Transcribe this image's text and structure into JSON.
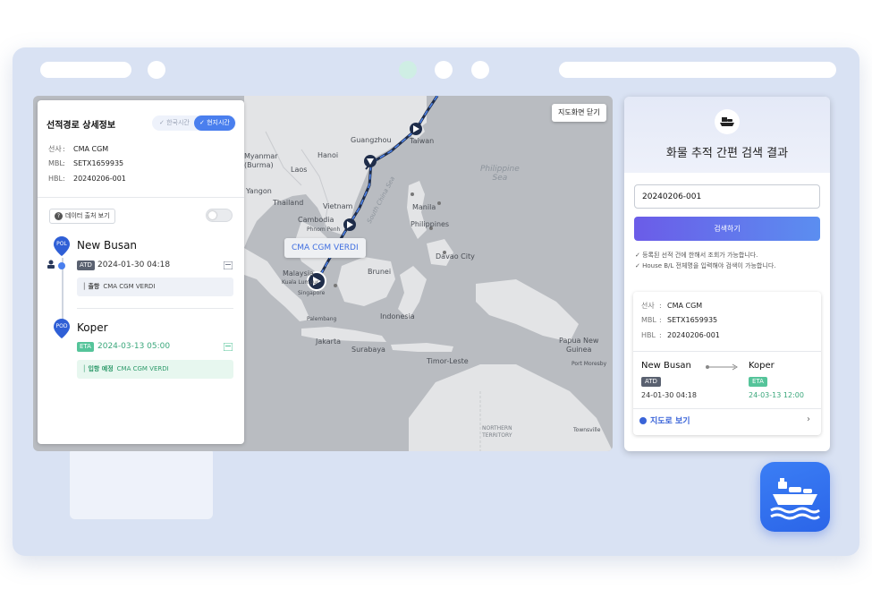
{
  "map": {
    "close_label": "지도화면 닫기",
    "vessel_label": "CMA CGM VERDI",
    "labels": {
      "taiwan": "Taiwan",
      "myanmar": "Myanmar\n(Burma)",
      "laos": "Laos",
      "yangon": "Yangon",
      "thailand": "Thailand",
      "vietnam": "Vietnam",
      "cambodia": "Cambodia",
      "philippine_sea": "Philippine\nSea",
      "philippines": "Philippines",
      "manila": "Manila",
      "davao": "Davao City",
      "malaysia": "Malaysia",
      "brunei": "Brunei",
      "singapore": "Singapore",
      "indonesia": "Indonesia",
      "jakarta": "Jakarta",
      "surabaya": "Surabaya",
      "timor_leste": "Timor-Leste",
      "papua": "Papua New\nGuinea",
      "port_moresby": "Port Moresby",
      "northern_territory": "NORTHERN\nTERRITORY",
      "townsville": "Townsville",
      "guangzhou": "Guangzhou",
      "hanoi": "Hanoi",
      "south_china_sea": "South China Sea",
      "phnom_penh": "Phnom Penh",
      "kuala_lumpur": "Kuala Lumpur",
      "palembang": "Palembang"
    }
  },
  "info": {
    "title": "선적경로 상세정보",
    "tz_kst": "한국시간",
    "tz_local": "현지시간",
    "carrier_key": "선사",
    "carrier_val": "CMA CGM",
    "mbl_key": "MBL",
    "mbl_val": "SETX1659935",
    "hbl_key": "HBL",
    "hbl_val": "20240206-001",
    "source_btn": "데이터 출처 보기",
    "pol_tag": "POL",
    "pod_tag": "POD",
    "pol_name": "New Busan",
    "pol_badge": "ATD",
    "pol_date": "2024-01-30 04:18",
    "pol_info_label": "출항",
    "pol_info_vessel": "CMA CGM VERDI",
    "pod_name": "Koper",
    "pod_badge": "ETA",
    "pod_date": "2024-03-13 05:00",
    "pod_info_label": "입항 예정",
    "pod_info_vessel": "CMA CGM VERDI"
  },
  "search": {
    "title": "화물 추적 간편 검색 결과",
    "input_value": "20240206-001",
    "button": "검색하기",
    "note1": "등록된 선적 건에 한해서 조회가 가능합니다.",
    "note2": "House B/L 전체명을 입력해야 검색이 가능합니다.",
    "carrier_key": "선사",
    "carrier_val": "CMA CGM",
    "mbl_key": "MBL",
    "mbl_val": "SETX1659935",
    "hbl_key": "HBL",
    "hbl_val": "20240206-001",
    "from_port": "New Busan",
    "from_badge": "ATD",
    "from_date": "24-01-30 04:18",
    "to_port": "Koper",
    "to_badge": "ETA",
    "to_date": "24-03-13 12:00",
    "map_link": "지도로 보기",
    "chevron": "›"
  },
  "colors": {
    "accent_blue": "#4a7fee",
    "route_dark": "#1f2d4a",
    "route_light": "#4f86f0",
    "eta_green": "#55c49a"
  }
}
